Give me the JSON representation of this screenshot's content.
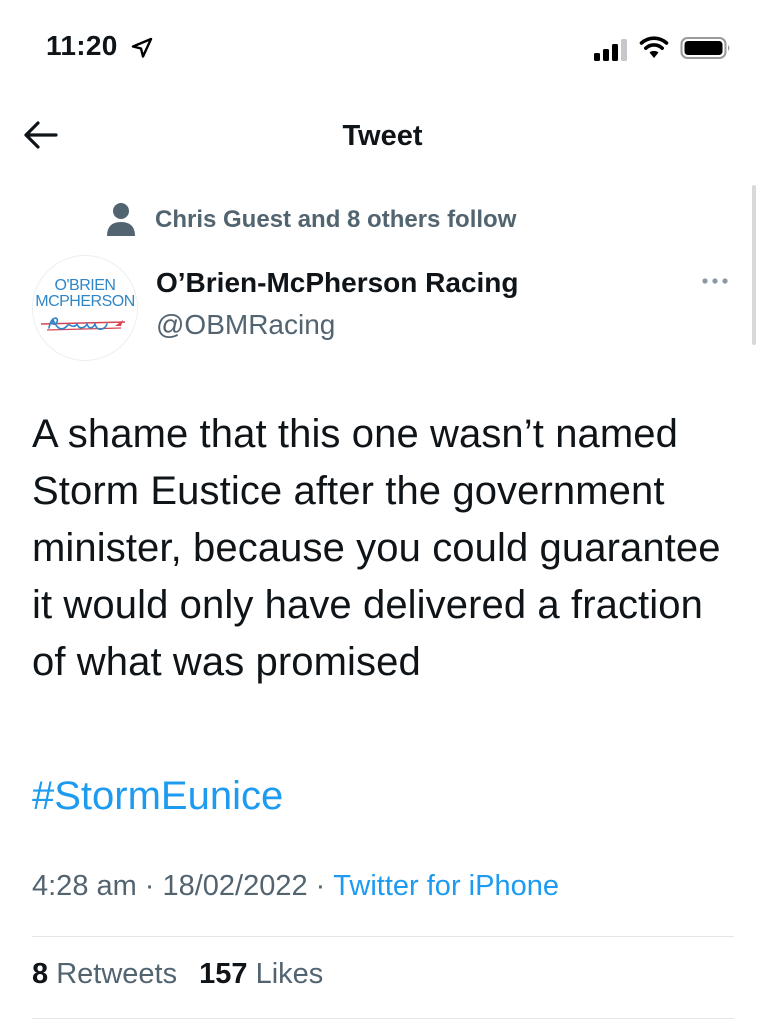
{
  "status_bar": {
    "time": "11:20",
    "icons": [
      "location-arrow-icon",
      "cellular-signal-icon",
      "wifi-icon",
      "battery-icon"
    ]
  },
  "nav": {
    "title": "Tweet",
    "back_icon": "arrow-left-icon"
  },
  "social_context": {
    "icon": "person-icon",
    "text": "Chris Guest and 8 others follow"
  },
  "author": {
    "display_name": "O’Brien-McPherson Racing",
    "handle": "@OBMRacing",
    "avatar": {
      "line1": "O'BRIEN",
      "line2": "MCPHERSON",
      "script": "Racing"
    }
  },
  "tweet": {
    "text": "A shame that this one wasn’t named Storm Eustice after the government minister, because you could guarantee it would only have delivered a fraction of what was promised",
    "hashtag": "#StormEunice"
  },
  "meta": {
    "time": "4:28 am",
    "date": "18/02/2022",
    "source": "Twitter for iPhone",
    "separator": "·"
  },
  "stats": {
    "retweets_count": "8",
    "retweets_label": "Retweets",
    "likes_count": "157",
    "likes_label": "Likes"
  },
  "colors": {
    "text": "#0f1419",
    "secondary": "#536471",
    "link": "#1d9bf0",
    "avatar_blue": "#2f86c8",
    "avatar_red": "#d64550"
  }
}
